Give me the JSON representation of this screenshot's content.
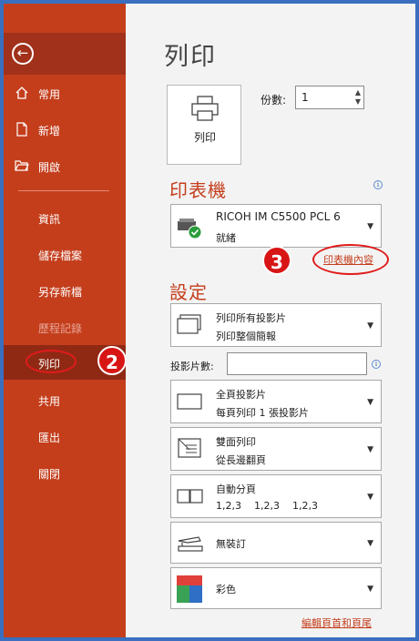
{
  "sidebar": {
    "items": [
      {
        "label": "常用",
        "icon": "home-icon"
      },
      {
        "label": "新增",
        "icon": "new-file-icon"
      },
      {
        "label": "開啟",
        "icon": "open-folder-icon"
      },
      {
        "label": "資訊"
      },
      {
        "label": "儲存檔案"
      },
      {
        "label": "另存新檔"
      },
      {
        "label": "歷程記錄"
      },
      {
        "label": "列印"
      },
      {
        "label": "共用"
      },
      {
        "label": "匯出"
      },
      {
        "label": "關閉"
      }
    ]
  },
  "main": {
    "title": "列印",
    "print_button_label": "列印",
    "copies_label": "份數:",
    "copies_value": "1",
    "printer_section": "印表機",
    "printer": {
      "name": "RICOH IM C5500 PCL 6",
      "status": "就緒"
    },
    "printer_properties_link": "印表機內容",
    "settings_section": "設定",
    "slides_range": {
      "line1": "列印所有投影片",
      "line2": "列印整個簡報"
    },
    "slides_field_label": "投影片數:",
    "slides_field_value": "",
    "layout": {
      "line1": "全頁投影片",
      "line2": "每頁列印 1 張投影片"
    },
    "sides": {
      "line1": "雙面列印",
      "line2": "從長邊翻頁"
    },
    "collate": {
      "line1": "自動分頁",
      "line2": "1,2,3    1,2,3    1,2,3"
    },
    "staple": {
      "line1": "無裝訂"
    },
    "color": {
      "line1": "彩色"
    },
    "header_footer_link": "編輯頁首和頁尾"
  },
  "annotations": {
    "badge_2": "2",
    "badge_3": "3"
  },
  "colors": {
    "accent": "#c43e1c",
    "sidebar": "#c43e1c",
    "highlight": "#e01b1b"
  }
}
